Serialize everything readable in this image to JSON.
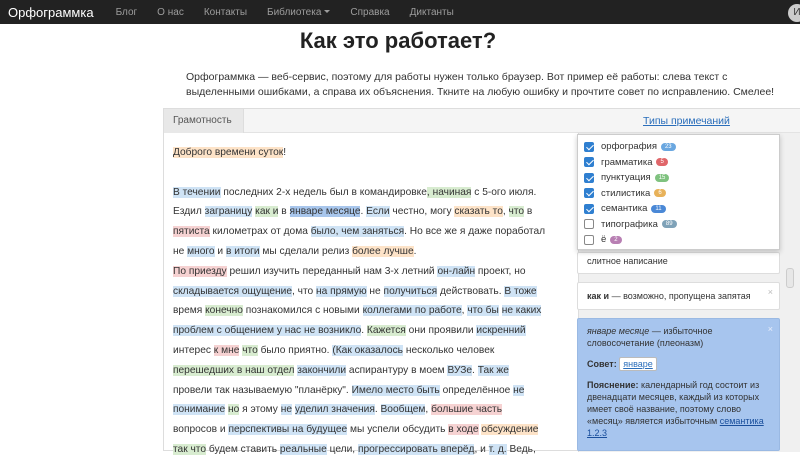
{
  "nav": {
    "brand": "Орфограммка",
    "links": [
      "Блог",
      "О нас",
      "Контакты",
      "Библиотека",
      "Справка",
      "Диктанты"
    ],
    "avatar": "И"
  },
  "page": {
    "title": "Как это работает?",
    "intro": "Орфограммка — веб-сервис, поэтому для работы нужен только браузер. Вот пример её работы: слева текст с выделенными ошибками, а справа их объяснения. Ткните на любую ошибку и прочтите совет по исправлению. Смелее!"
  },
  "panel": {
    "tab": "Грамотность",
    "types_link": "Типы примечаний"
  },
  "filters": [
    {
      "label": "орфография",
      "count": "23",
      "color": "#6aa7e0",
      "checked": true
    },
    {
      "label": "грамматика",
      "count": "5",
      "color": "#e0666a",
      "checked": true
    },
    {
      "label": "пунктуация",
      "count": "15",
      "color": "#7fc27f",
      "checked": true
    },
    {
      "label": "стилистика",
      "count": "6",
      "color": "#e8b25a",
      "checked": true
    },
    {
      "label": "семантика",
      "count": "11",
      "color": "#4a88d6",
      "checked": true
    },
    {
      "label": "типографика",
      "count": "89",
      "color": "#7fa2b8",
      "checked": false
    },
    {
      "label": "ё",
      "count": "2",
      "color": "#b87fb3",
      "checked": false
    }
  ],
  "cards": {
    "c1_text": "слитное написание",
    "c2_bold": "как и",
    "c2_rest": " — возможно, пропущена запятая",
    "c3_italic": "январе месяце",
    "c3_rest": " — избыточное словосочетание (плеоназм)",
    "c3_advice_label": "Совет:",
    "c3_advice_value": "январе",
    "c3_expl_label": "Пояснение:",
    "c3_expl_text": " календарный год состоит из двенадцати месяцев, каждый из которых имеет своё название, поэтому слово «месяц» является избыточным ",
    "c3_link": "семантика",
    "c3_link2": "1.2.3",
    "close": "×"
  },
  "text": {
    "s0": "Доброго времени суток",
    "s0b": "!",
    "l1a": "В течении",
    "l1b": " последних 2-х недель был в командировке",
    "l1c": ", начиная",
    "l1d": " с 5-ого июля.",
    "l2a": "Ездил ",
    "l2b": "заграницу",
    "l2c": " ",
    "l2d": "как и",
    "l2e": " в ",
    "l2f": "январе месяце",
    "l2g": ". ",
    "l2h": "Если",
    "l2i": " честно, могу ",
    "l2j": "сказать то",
    "l2k": ", ",
    "l2l": "что",
    "l2m": " в",
    "l3a": "пятиста",
    "l3b": " километрах от дома ",
    "l3c": "было, чем заняться",
    "l3d": ". Но все же я даже поработал",
    "l4a": "не ",
    "l4b": "много",
    "l4c": " и ",
    "l4d": "в итоги",
    "l4e": " мы сделали релиз ",
    "l4f": "более лучше",
    "l4g": ".",
    "l5a": "По приезду",
    "l5b": " решил изучить переданный нам 3-х летний ",
    "l5c": "он-лайн",
    "l5d": " проект, но",
    "l6a": "складывается ощущение",
    "l6b": ", что ",
    "l6c": "на прямую",
    "l6d": " не ",
    "l6e": "получиться",
    "l6f": " действовать. ",
    "l6g": "В тоже",
    "l7a": "время ",
    "l7b": "конечно",
    "l7c": " познакомился с новыми ",
    "l7d": "коллегами по работе",
    "l7e": ", ",
    "l7f": "что бы",
    "l7g": " ",
    "l7h": "не каких",
    "l8a": "проблем с общением у нас не возникло",
    "l8b": ". ",
    "l8c": "Кажется",
    "l8d": " они проявили ",
    "l8e": "искренний",
    "l9a": "интерес ",
    "l9b": "к мне",
    "l9c": " ",
    "l9d": "что",
    "l9e": " было приятно. ",
    "l9f": "(Как оказалось",
    "l9g": " несколько человек",
    "l10a": "перешедших в наш отдел",
    "l10b": " ",
    "l10c": "закончили",
    "l10d": " аспирантуру в моем ",
    "l10e": "ВУЗе",
    "l10f": ". ",
    "l10g": "Так же",
    "l11a": "провели так называемую \"планёрку\". ",
    "l11b": "Имело место быть",
    "l11c": " определённое ",
    "l11d": "не",
    "l12a": "понимание",
    "l12b": " ",
    "l12c": "но",
    "l12d": " я этому ",
    "l12e": "не",
    "l12f": " ",
    "l12g": "уделил значения",
    "l12h": ". ",
    "l12i": "Вообщем",
    "l12j": ", ",
    "l12k": "большие часть",
    "l13a": "вопросов и ",
    "l13b": "перспективы на будущее",
    "l13c": " мы успели обсудить ",
    "l13d": "в ходе",
    "l13e": " ",
    "l13f": "обсуждение",
    "l14a": "так что",
    "l14b": " будем ставить ",
    "l14c": "реальные",
    "l14d": " цели, ",
    "l14e": "прогрессировать вперёд",
    "l14f": ", и ",
    "l14g": "т. д.",
    "l14h": " Ведь,"
  }
}
